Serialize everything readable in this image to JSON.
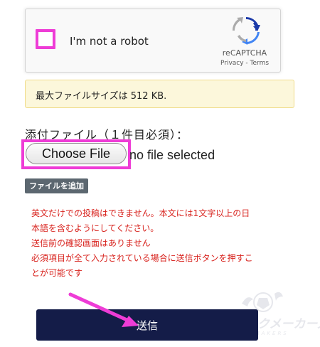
{
  "recaptcha": {
    "label": "I'm not a robot",
    "brand": "reCAPTCHA",
    "links": "Privacy - Terms",
    "icon": "recaptcha-logo-icon"
  },
  "upload": {
    "max_size_notice": "最大ファイルサイズは 512 KB.",
    "attach_label": "添付ファイル（１件目必須）：",
    "choose_file_label": "Choose File",
    "no_file_text": "no file selected",
    "add_file_label": "ファイルを追加"
  },
  "notice": {
    "lines": [
      "英文だけでの投稿はできません。本文には1文字以上の日",
      "本語を含むようにしてください。",
      "送信前の確認画面はありません",
      "必須項目が全て入力されている場合に送信ボタンを押すこ",
      "とが可能です"
    ]
  },
  "submit": {
    "label": "送信"
  },
  "watermark": {
    "title": "ザ・ブックメーカーズ",
    "subtitle": "THE BOOKMAKERS"
  },
  "colors": {
    "highlight": "#ee3cd6",
    "submit_bg": "#141c48",
    "notice_red": "#d8231e",
    "info_bg": "#fcf7db"
  }
}
